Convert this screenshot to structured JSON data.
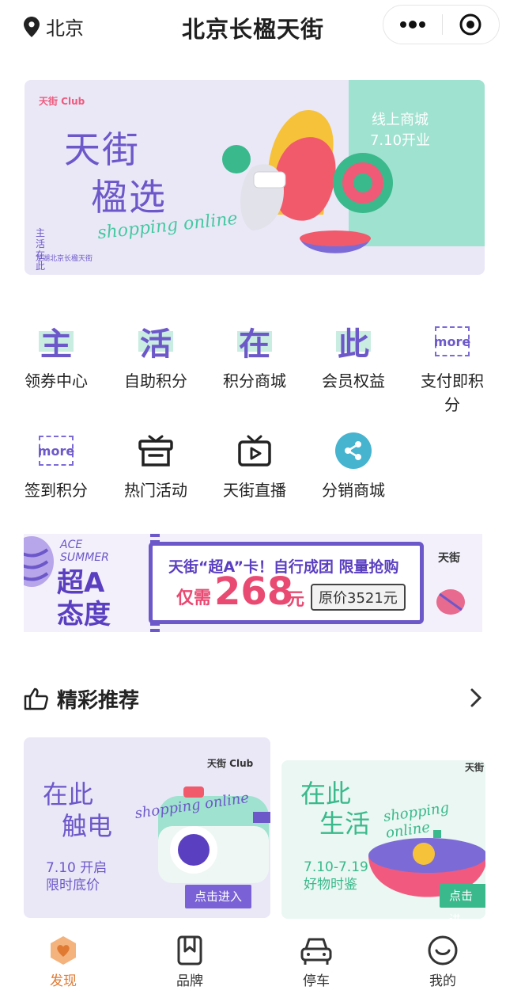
{
  "header": {
    "location": "北京",
    "title": "北京长楹天街",
    "icons": {
      "location": "location-pin-icon",
      "more": "more-dots-icon",
      "close": "target-icon"
    }
  },
  "hero": {
    "club": "天街 Club",
    "title_line1": "天街",
    "title_line2": "楹选",
    "script": "shopping online",
    "side_text": "主活在此",
    "sub_text": "龙湖北京长楹天街",
    "badge_line1": "线上商城",
    "badge_line2": "7.10开业"
  },
  "grid": [
    {
      "glyph": "主",
      "label": "领券中心"
    },
    {
      "glyph": "活",
      "label": "自助积分"
    },
    {
      "glyph": "在",
      "label": "积分商城"
    },
    {
      "glyph": "此",
      "label": "会员权益"
    },
    {
      "glyph": "more",
      "label": "支付即积分"
    },
    {
      "glyph": "more",
      "label": "签到积分"
    },
    {
      "icon": "gift-box-icon",
      "label": "热门活动"
    },
    {
      "icon": "tv-play-icon",
      "label": "天街直播"
    },
    {
      "icon": "share-icon",
      "label": "分销商城"
    }
  ],
  "promo": {
    "ace": "ACE",
    "summer": "SUMMER",
    "big_line1": "超A",
    "big_line2": "态度",
    "headline": "天街“超A”卡！自行成团 限量抢购",
    "need": "仅需",
    "price": "268",
    "unit": "元",
    "original": "原价3521元",
    "logo": "天街"
  },
  "section": {
    "title": "精彩推荐",
    "icon": "thumbs-up-icon"
  },
  "cards": [
    {
      "club": "天街 Club",
      "title_line1": "在此",
      "title_line2": "触电",
      "script": "shopping online",
      "sub1": "7.10 开启",
      "sub2": "限时底价",
      "button": "点击进入"
    },
    {
      "club": "天街",
      "title_line1": "在此",
      "title_line2": "生活",
      "script": "shopping online",
      "sub1": "7.10-7.19",
      "sub2": "好物时鉴",
      "button": "点击进"
    }
  ],
  "tabs": [
    {
      "label": "发现",
      "icon": "discover-heart-icon",
      "active": true
    },
    {
      "label": "品牌",
      "icon": "bookmark-icon",
      "active": false
    },
    {
      "label": "停车",
      "icon": "car-icon",
      "active": false
    },
    {
      "label": "我的",
      "icon": "smile-face-icon",
      "active": false
    }
  ],
  "colors": {
    "accent": "#6d58c9",
    "mint": "#9fe2cf",
    "active_tab": "#e07a33",
    "price": "#e94a72"
  }
}
